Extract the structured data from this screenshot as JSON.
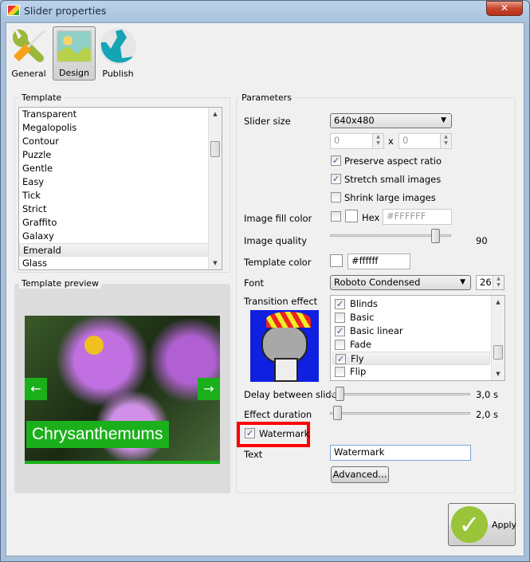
{
  "window": {
    "title": "Slider properties",
    "close_label": "✕"
  },
  "toolbar": {
    "items": [
      {
        "label": "General",
        "icon": "wrench-screwdriver-icon"
      },
      {
        "label": "Design",
        "icon": "picture-icon",
        "selected": true
      },
      {
        "label": "Publish",
        "icon": "globe-icon"
      }
    ]
  },
  "template": {
    "label": "Template",
    "items": [
      "Transparent",
      "Megalopolis",
      "Contour",
      "Puzzle",
      "Gentle",
      "Easy",
      "Tick",
      "Strict",
      "Graffito",
      "Galaxy",
      "Emerald",
      "Glass"
    ],
    "selected": "Emerald"
  },
  "preview": {
    "label": "Template preview",
    "caption": "Chrysanthemums",
    "accent": "#1bb01b"
  },
  "parameters": {
    "label": "Parameters",
    "slider_size": {
      "label": "Slider size",
      "value": "640x480",
      "width": "0",
      "height": "0",
      "x_label": "x"
    },
    "preserve_aspect": {
      "label": "Preserve aspect ratio",
      "checked": true
    },
    "stretch_small": {
      "label": "Stretch small images",
      "checked": true
    },
    "shrink_large": {
      "label": "Shrink large images",
      "checked": false
    },
    "image_fill": {
      "label": "Image fill color",
      "checked": false,
      "hex_label": "Hex",
      "hex_value": "#FFFFFF"
    },
    "image_quality": {
      "label": "Image quality",
      "value": "90",
      "percent": 90
    },
    "template_color": {
      "label": "Template color",
      "value": "#ffffff"
    },
    "font": {
      "label": "Font",
      "value": "Roboto Condensed",
      "size": "26"
    },
    "transition": {
      "label": "Transition effect",
      "items": [
        {
          "label": "Blinds",
          "checked": true
        },
        {
          "label": "Basic",
          "checked": false
        },
        {
          "label": "Basic linear",
          "checked": true
        },
        {
          "label": "Fade",
          "checked": false
        },
        {
          "label": "Fly",
          "checked": true,
          "selected": true
        },
        {
          "label": "Flip",
          "checked": false
        }
      ]
    },
    "delay": {
      "label": "Delay between slides",
      "value": "3,0 s"
    },
    "duration": {
      "label": "Effect duration",
      "value": "2,0 s"
    },
    "watermark": {
      "label": "Watermark",
      "checked": true,
      "highlight": "#ff0000"
    },
    "text": {
      "label": "Text",
      "value": "Watermark"
    },
    "advanced_label": "Advanced..."
  },
  "apply_label": "Apply"
}
